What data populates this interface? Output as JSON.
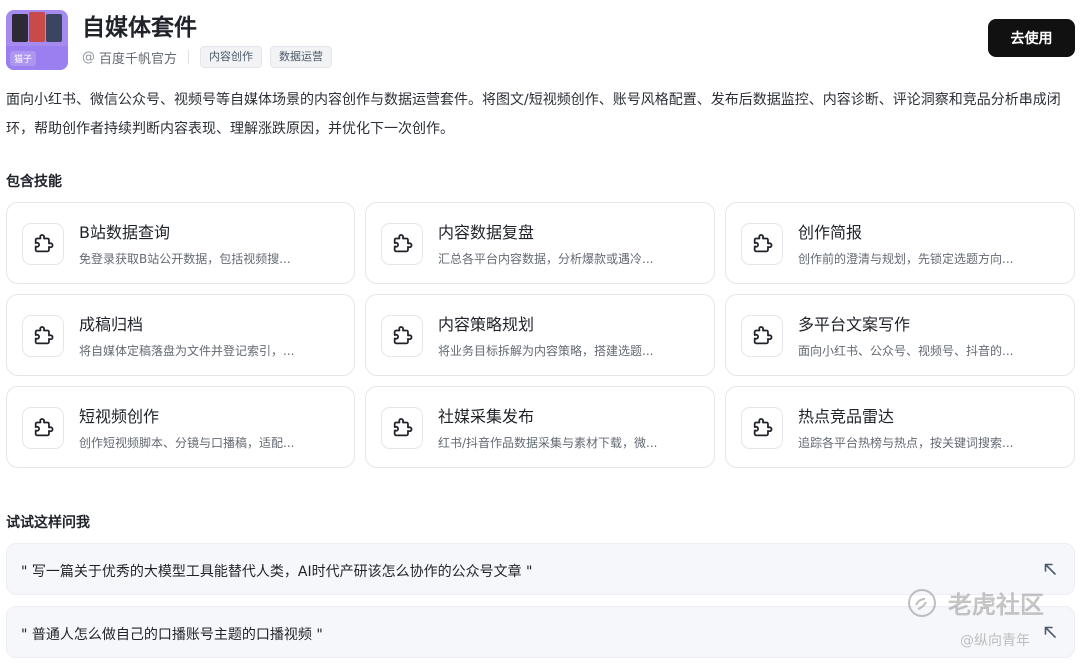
{
  "header": {
    "logo_tag": "猫子",
    "title": "自媒体套件",
    "author_prefix": "@",
    "author": "百度千帆官方",
    "tags": [
      "内容创作",
      "数据运营"
    ],
    "use_button": "去使用"
  },
  "description": "面向小红书、微信公众号、视频号等自媒体场景的内容创作与数据运营套件。将图文/短视频创作、账号风格配置、发布后数据监控、内容诊断、评论洞察和竞品分析串成闭环，帮助创作者持续判断内容表现、理解涨跌原因，并优化下一次创作。",
  "skills_section": {
    "title": "包含技能",
    "items": [
      {
        "name": "B站数据查询",
        "desc": "免登录获取B站公开数据，包括视频搜..."
      },
      {
        "name": "内容数据复盘",
        "desc": "汇总各平台内容数据，分析爆款或遇冷..."
      },
      {
        "name": "创作简报",
        "desc": "创作前的澄清与规划，先锁定选题方向..."
      },
      {
        "name": "成稿归档",
        "desc": "将自媒体定稿落盘为文件并登记索引，..."
      },
      {
        "name": "内容策略规划",
        "desc": "将业务目标拆解为内容策略，搭建选题..."
      },
      {
        "name": "多平台文案写作",
        "desc": "面向小红书、公众号、视频号、抖音的..."
      },
      {
        "name": "短视频创作",
        "desc": "创作短视频脚本、分镜与口播稿，适配..."
      },
      {
        "name": "社媒采集发布",
        "desc": "红书/抖音作品数据采集与素材下载，微..."
      },
      {
        "name": "热点竞品雷达",
        "desc": "追踪各平台热榜与热点，按关键词搜索..."
      }
    ],
    "item_icon": "puzzle-icon"
  },
  "try_section": {
    "title": "试试这样问我",
    "prompts": [
      "\" 写一篇关于优秀的大模型工具能替代人类，AI时代产研该怎么协作的公众号文章 \"",
      "\" 普通人怎么做自己的口播账号主题的口播视频 \""
    ],
    "prompt_icon": "arrow-up-left-icon"
  },
  "watermark": {
    "brand": "老虎社区",
    "handle": "@纵向青年"
  }
}
